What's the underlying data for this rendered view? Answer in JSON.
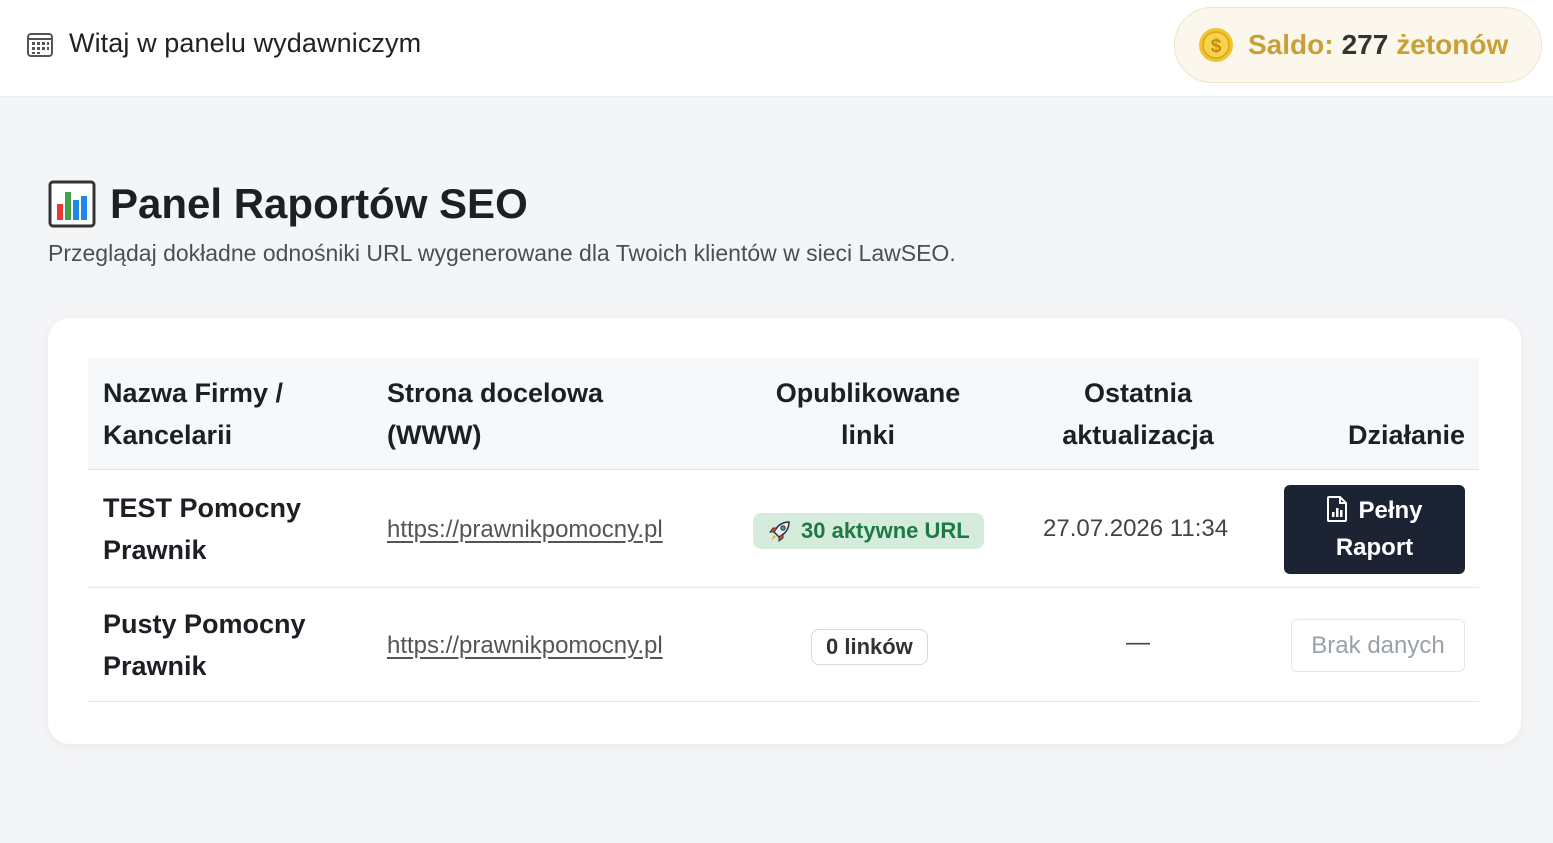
{
  "header": {
    "title": "Witaj w panelu wydawniczym",
    "balance_label": "Saldo:",
    "balance_value": "277",
    "balance_unit": "żetonów",
    "accent": "#c9a036"
  },
  "page": {
    "title": "Panel Raportów SEO",
    "subtitle": "Przeglądaj dokładne odnośniki URL wygenerowane dla Twoich klientów w sieci LawSEO."
  },
  "table": {
    "columns": {
      "name_line1": "Nazwa Firmy /",
      "name_line2": "Kancelarii",
      "url_line1": "Strona docelowa",
      "url_line2": "(WWW)",
      "links_line1": "Opublikowane",
      "links_line2": "linki",
      "updated_line1": "Ostatnia",
      "updated_line2": "aktualizacja",
      "action": "Działanie"
    },
    "rows": [
      {
        "name_line1": "TEST Pomocny",
        "name_line2": "Prawnik",
        "url": "https://prawnikpomocny.pl",
        "links": "30 aktywne URL",
        "updated": "27.07.2026 11:34",
        "action_line1": "Pełny",
        "action_line2": "Raport"
      },
      {
        "name_line1": "Pusty Pomocny",
        "name_line2": "Prawnik",
        "url": "https://prawnikpomocny.pl",
        "links": "0 linków",
        "updated": "—",
        "action": "Brak danych"
      }
    ]
  }
}
